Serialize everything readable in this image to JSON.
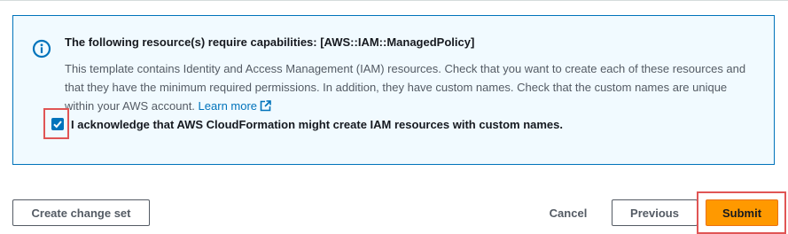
{
  "alert": {
    "title": "The following resource(s) require capabilities: [AWS::IAM::ManagedPolicy]",
    "body": "This template contains Identity and Access Management (IAM) resources. Check that you want to create each of these resources and that they have the minimum required permissions. In addition, they have custom names. Check that the custom names are unique within your AWS account.",
    "learn_more": "Learn more",
    "info_icon": "info-icon",
    "external_icon": "external-link-icon",
    "color_border": "#0073bb",
    "color_background": "#f1faff"
  },
  "acknowledgement": {
    "checked": true,
    "label": "I acknowledge that AWS CloudFormation might create IAM resources with custom names."
  },
  "buttons": {
    "create_change_set": "Create change set",
    "cancel": "Cancel",
    "previous": "Previous",
    "submit": "Submit"
  },
  "colors": {
    "primary": "#ff9900",
    "link": "#0073bb",
    "highlight": "#e05555"
  }
}
